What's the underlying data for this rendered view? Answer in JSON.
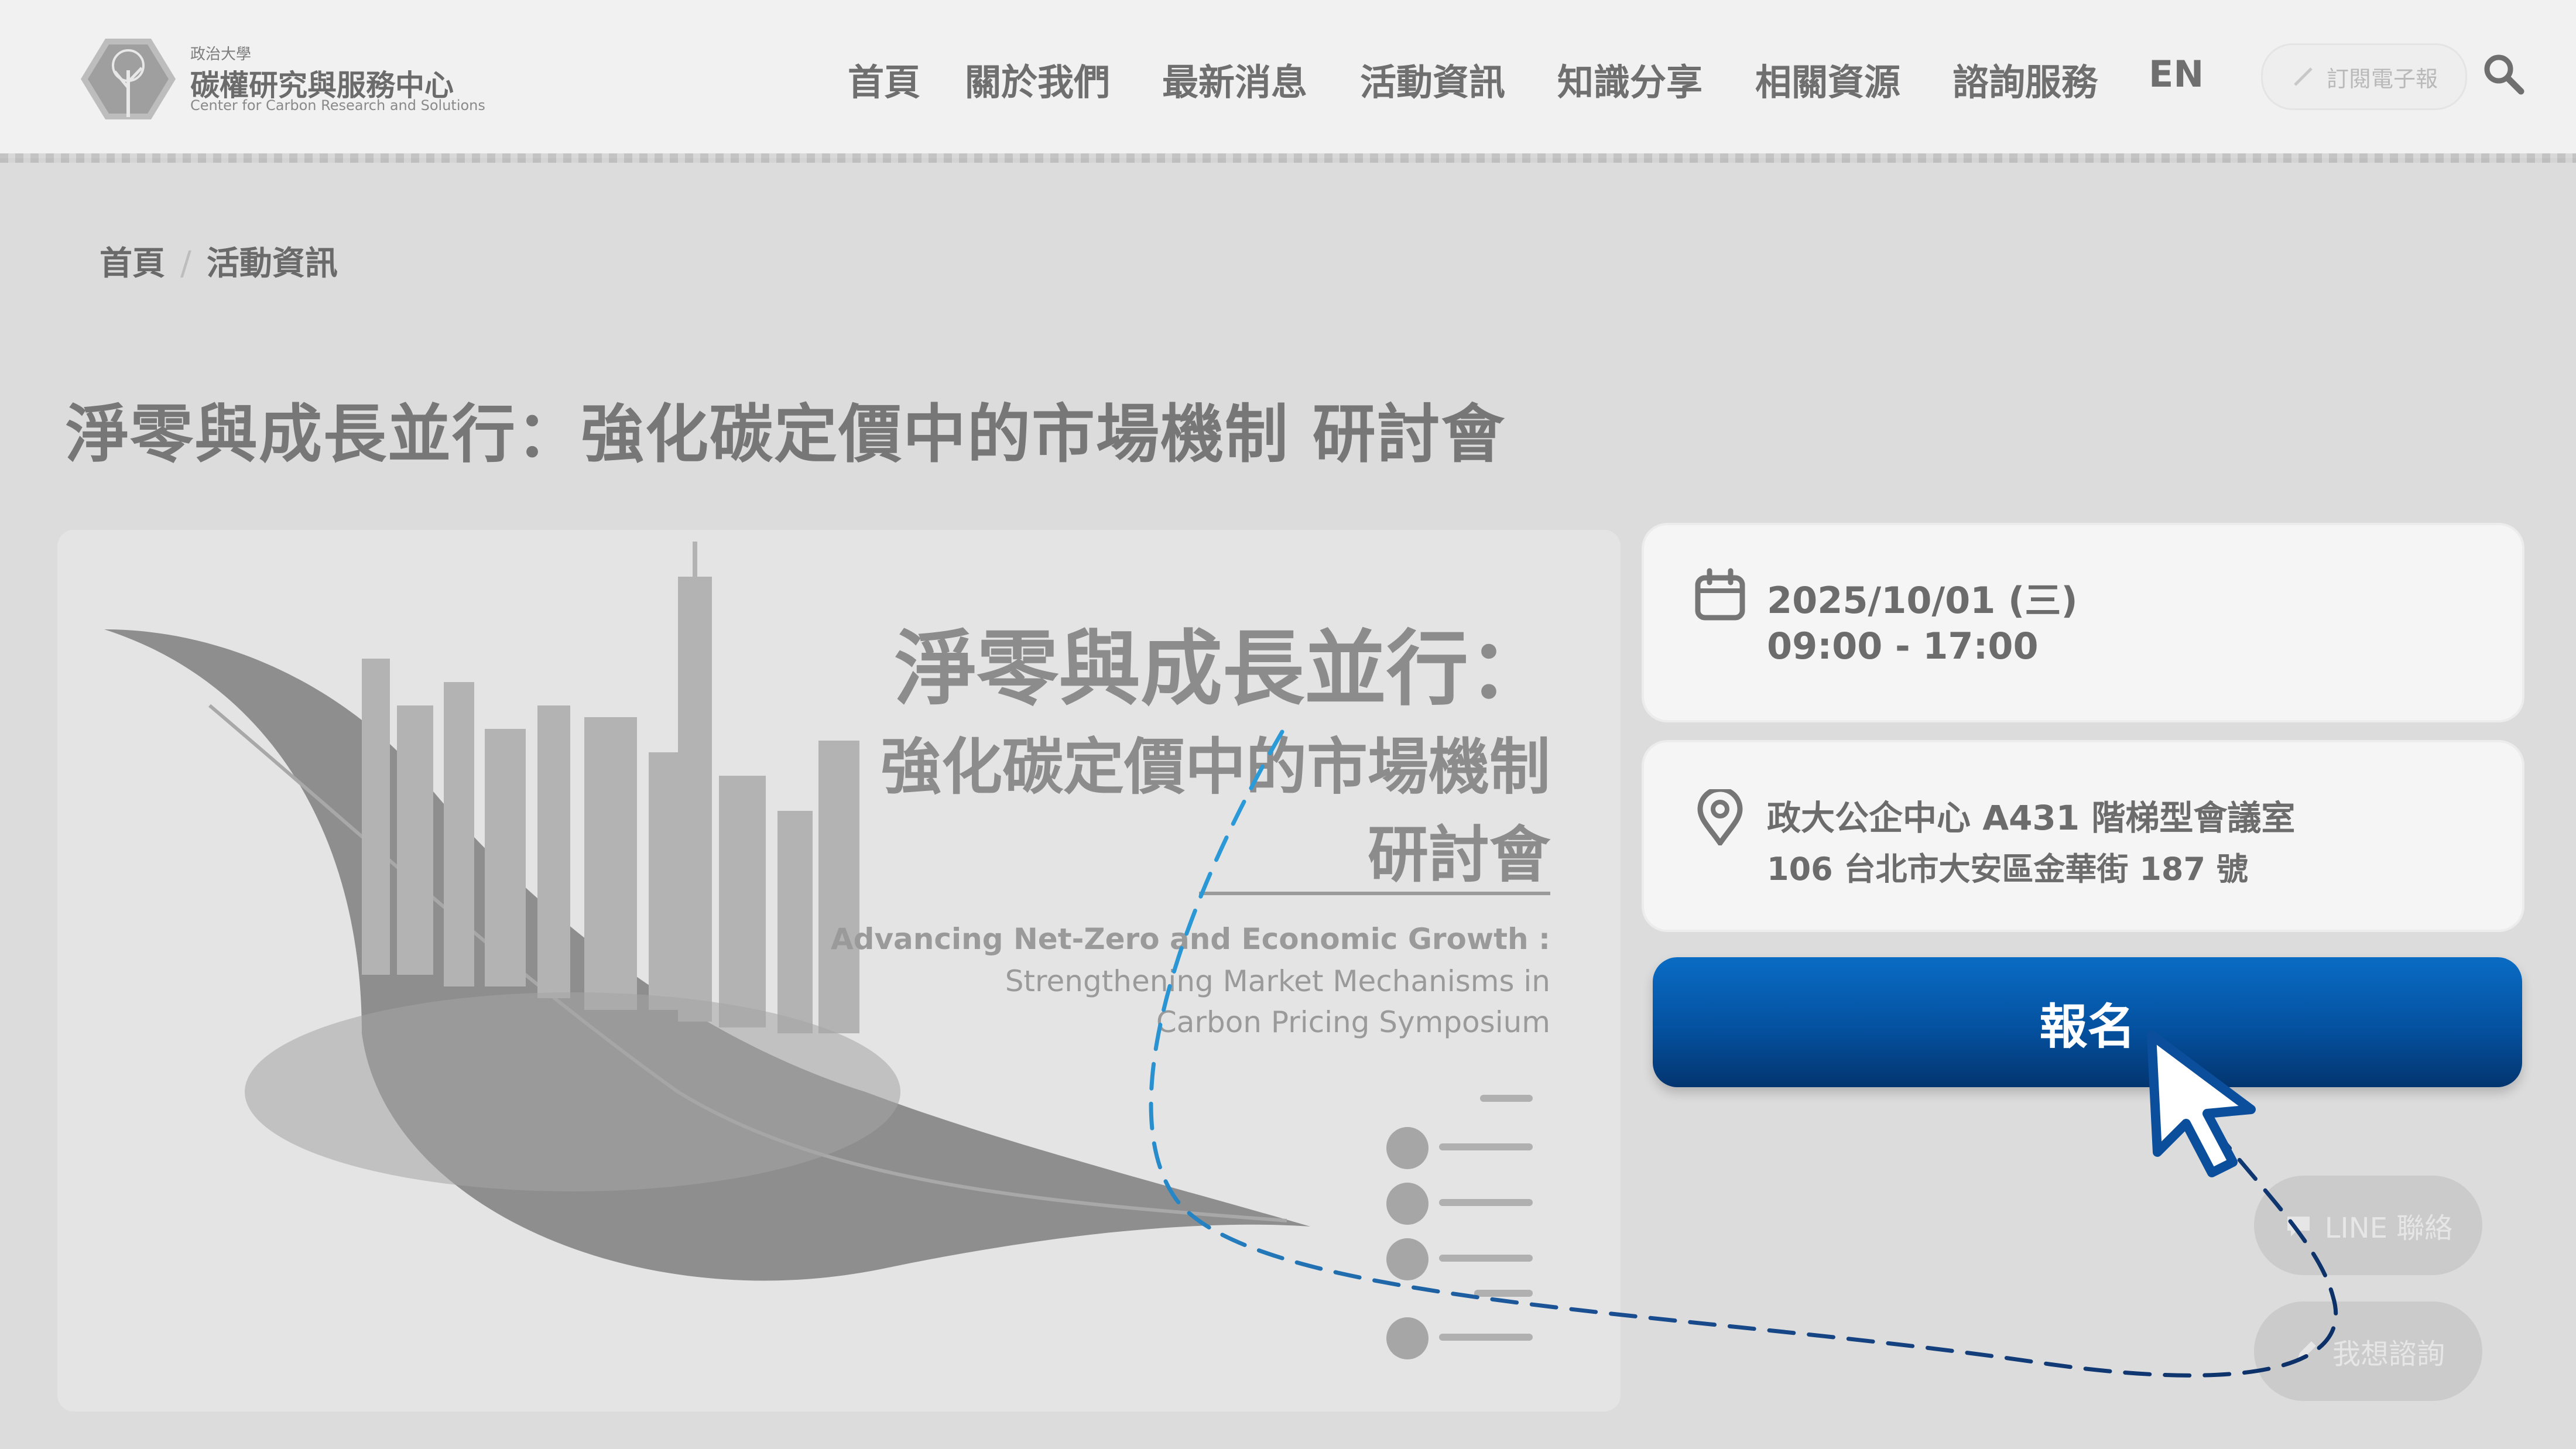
{
  "header": {
    "logo_top": "政治大學",
    "logo_main": "碳權研究與服務中心",
    "logo_sub": "Center for Carbon Research and Solutions",
    "nav": [
      "首頁",
      "關於我們",
      "最新消息",
      "活動資訊",
      "知識分享",
      "相關資源",
      "諮詢服務",
      "EN"
    ],
    "newsletter_label": "訂閱電子報",
    "search_icon": "search-icon"
  },
  "breadcrumb": {
    "home": "首頁",
    "separator": "/",
    "current": "活動資訊"
  },
  "page_title": "淨零與成長並行：強化碳定價中的市場機制 研討會",
  "poster": {
    "title_line1": "淨零與成長並行：",
    "title_line2": "強化碳定價中的市場機制",
    "title_line3": "研討會",
    "en_line1": "Advancing Net-Zero and Economic Growth :",
    "en_line2": "Strengthening Market Mechanisms in",
    "en_line3": "Carbon Pricing Symposium"
  },
  "event": {
    "date": "2025/10/01 (三)",
    "time": "09:00 - 17:00",
    "venue": "政大公企中心 A431 階梯型會議室",
    "address": "106 台北市大安區金華街 187 號"
  },
  "register_label": "報名",
  "floating": {
    "line_label": "LINE 聯絡",
    "consult_label": "我想諮詢"
  },
  "colors": {
    "register_top": "#0a6cc4",
    "register_bottom": "#03356f",
    "background": "#dcdcdc",
    "path_light": "#2b9ad8",
    "path_dark": "#0c2f66"
  }
}
